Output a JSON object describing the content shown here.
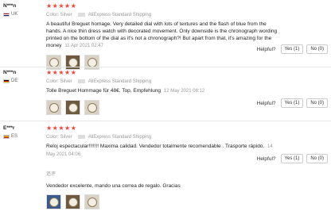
{
  "reviews": [
    {
      "user": "N***n",
      "country": "UK",
      "flag": "uk",
      "stars": "★★★★★",
      "color": "Color: Silver",
      "shipping": "AliExpress Standard Shipping",
      "text": "A beautiful Breguet homage. Very detailed dial with lots of textures and the flash of blue from the hands. A nice thin dress watch with decorated movement. Only downside is the chronograph wording printed on the bottom of the dial as it's not a chronograph?! But apart from that, it's amazing for the money",
      "date": "11 Apr 2021 02:47",
      "helpful_label": "Helpful?",
      "yes": "Yes (1)",
      "no": "No (0)"
    },
    {
      "user": "N***n",
      "country": "DE",
      "flag": "de",
      "stars": "★★★★★",
      "color": "Color: Silver",
      "shipping": "AliExpress Standard Shipping",
      "text": "Tolle Breguet Hommage für 48€. Top, Empfehlung",
      "date": "12 May 2021 08:12",
      "helpful_label": "Helpful?",
      "yes": "Yes (1)",
      "no": "No (0)"
    },
    {
      "user": "E***r",
      "country": "ES",
      "flag": "es",
      "stars": "★★★★★",
      "color": "Color: Silver",
      "shipping": "AliExpress Standard Shipping",
      "text": "Reloj espectacular!!!!!!! Maxima calidad. Vendedor totalmente recomendable . Trasporte rápido.",
      "date": "14 May 2021 04:06",
      "helpful_label": "Helpful?",
      "yes": "Yes (1)",
      "no": "No (0)"
    }
  ],
  "followup": {
    "label": "追评",
    "text": "Vendedor excelente, mando una correa de regalo. Gracias"
  }
}
